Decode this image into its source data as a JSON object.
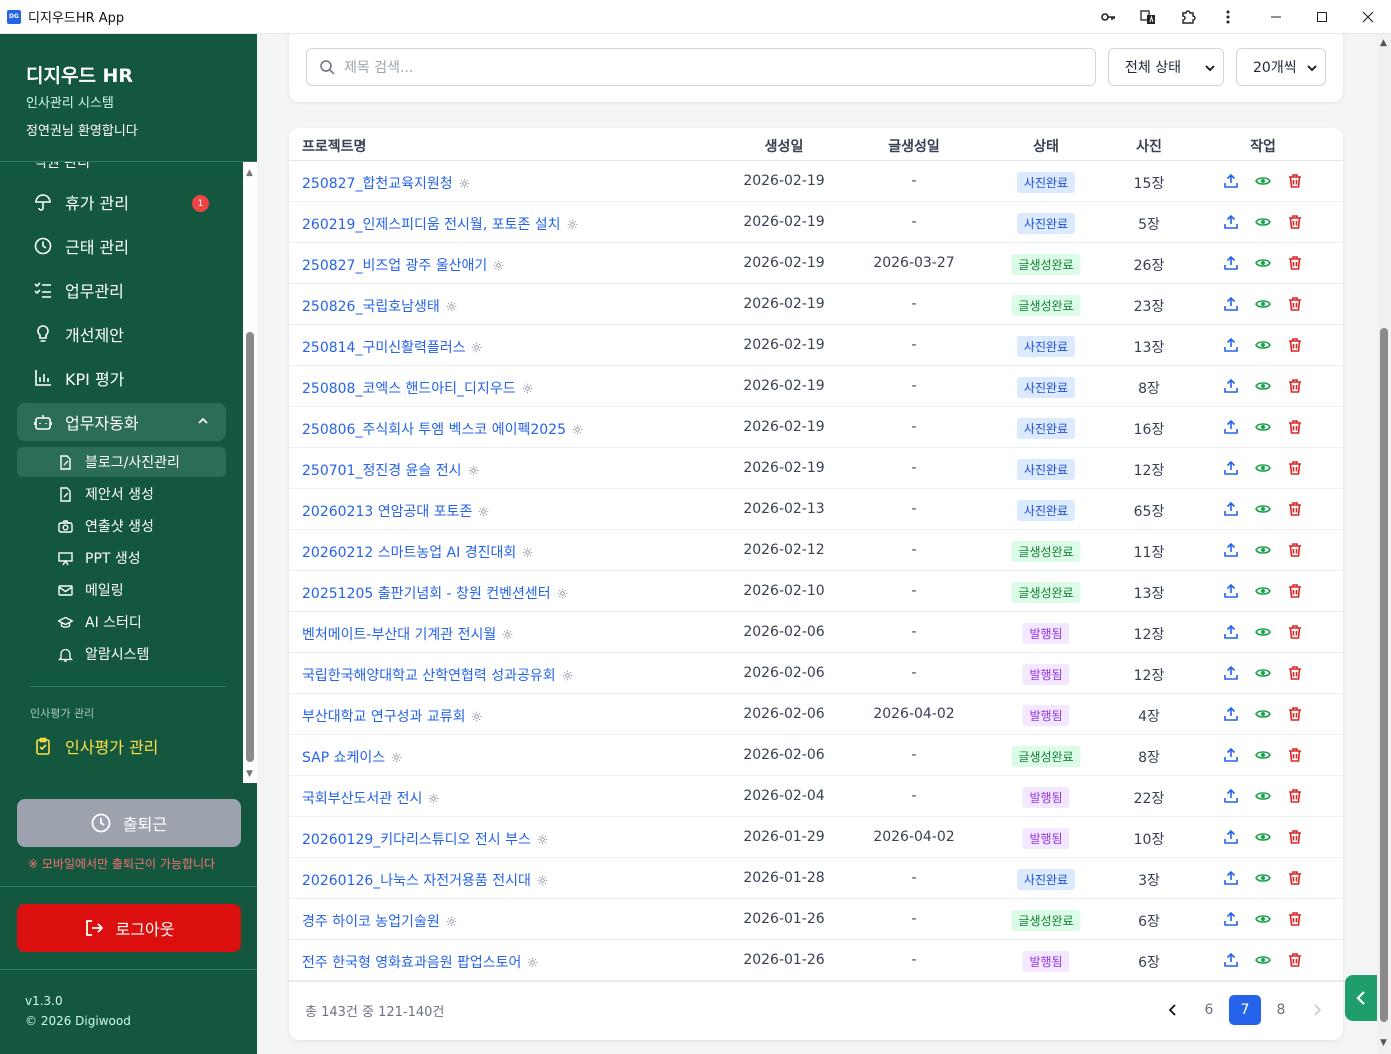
{
  "window": {
    "title": "디지우드HR App",
    "logo_text": "DG"
  },
  "sidebar": {
    "brand": "디지우드 HR",
    "subtitle": "인사관리 시스템",
    "welcome": "정연권님 환영합니다",
    "cut_item": "직원 관리",
    "items": [
      {
        "label": "휴가 관리",
        "icon": "umbrella-icon",
        "badge": "1"
      },
      {
        "label": "근태 관리",
        "icon": "clock-icon"
      },
      {
        "label": "업무관리",
        "icon": "task-list-icon"
      },
      {
        "label": "개선제안",
        "icon": "lightbulb-icon"
      },
      {
        "label": "KPI 평가",
        "icon": "bar-chart-icon"
      },
      {
        "label": "업무자동화",
        "icon": "robot-icon",
        "expanded": true
      }
    ],
    "sub_items": [
      {
        "label": "블로그/사진관리",
        "icon": "document-icon",
        "active": true
      },
      {
        "label": "제안서 생성",
        "icon": "document-icon"
      },
      {
        "label": "연출샷 생성",
        "icon": "camera-icon"
      },
      {
        "label": "PPT 생성",
        "icon": "presentation-icon"
      },
      {
        "label": "메일링",
        "icon": "mail-icon"
      },
      {
        "label": "AI 스터디",
        "icon": "graduation-cap-icon"
      },
      {
        "label": "알람시스템",
        "icon": "bell-icon"
      }
    ],
    "section_label": "인사평가 관리",
    "eval_item": "인사평가 관리",
    "clock_button": "출퇴근",
    "clock_note": "※ 모바일에서만 출퇴근이 가능합니다",
    "logout_button": "로그아웃",
    "version": "v1.3.0",
    "copyright": "© 2026 Digiwood"
  },
  "filters": {
    "search_placeholder": "제목 검색...",
    "status_select": "전체 상태",
    "page_size_select": "20개씩"
  },
  "table": {
    "headers": {
      "name": "프로젝트명",
      "created": "생성일",
      "written": "글생성일",
      "status": "상태",
      "photos": "사진",
      "actions": "작업"
    },
    "rows": [
      {
        "name": "250827_합천교육지원청",
        "created": "2026-02-19",
        "written": "-",
        "status": "사진완료",
        "photos": "15장"
      },
      {
        "name": "260219_인제스피디움 전시월, 포토존 설치",
        "created": "2026-02-19",
        "written": "-",
        "status": "사진완료",
        "photos": "5장"
      },
      {
        "name": "250827_비즈업 광주 울산애기",
        "created": "2026-02-19",
        "written": "2026-03-27",
        "status": "글생성완료",
        "photos": "26장"
      },
      {
        "name": "250826_국립호남생태",
        "created": "2026-02-19",
        "written": "-",
        "status": "글생성완료",
        "photos": "23장"
      },
      {
        "name": "250814_구미신활력플러스",
        "created": "2026-02-19",
        "written": "-",
        "status": "사진완료",
        "photos": "13장"
      },
      {
        "name": "250808_코엑스 핸드아티_디지우드",
        "created": "2026-02-19",
        "written": "-",
        "status": "사진완료",
        "photos": "8장"
      },
      {
        "name": "250806_주식회사 투엠 벡스코 에이펙2025",
        "created": "2026-02-19",
        "written": "-",
        "status": "사진완료",
        "photos": "16장"
      },
      {
        "name": "250701_정진경 윤슬 전시",
        "created": "2026-02-19",
        "written": "-",
        "status": "사진완료",
        "photos": "12장"
      },
      {
        "name": "20260213 연암공대 포토존",
        "created": "2026-02-13",
        "written": "-",
        "status": "사진완료",
        "photos": "65장"
      },
      {
        "name": "20260212 스마트농업 AI 경진대회",
        "created": "2026-02-12",
        "written": "-",
        "status": "글생성완료",
        "photos": "11장"
      },
      {
        "name": "20251205 출판기념회 - 창원 컨벤션센터",
        "created": "2026-02-10",
        "written": "-",
        "status": "글생성완료",
        "photos": "13장"
      },
      {
        "name": "벤처메이트-부산대 기계관 전시월",
        "created": "2026-02-06",
        "written": "-",
        "status": "발행됨",
        "photos": "12장"
      },
      {
        "name": "국립한국해양대학교 산학연협력 성과공유회",
        "created": "2026-02-06",
        "written": "-",
        "status": "발행됨",
        "photos": "12장"
      },
      {
        "name": "부산대학교 연구성과 교류회",
        "created": "2026-02-06",
        "written": "2026-04-02",
        "status": "발행됨",
        "photos": "4장"
      },
      {
        "name": "SAP 쇼케이스",
        "created": "2026-02-06",
        "written": "-",
        "status": "글생성완료",
        "photos": "8장"
      },
      {
        "name": "국회부산도서관 전시",
        "created": "2026-02-04",
        "written": "-",
        "status": "발행됨",
        "photos": "22장"
      },
      {
        "name": "20260129_키다리스튜디오 전시 부스",
        "created": "2026-01-29",
        "written": "2026-04-02",
        "status": "발행됨",
        "photos": "10장"
      },
      {
        "name": "20260126_나눅스 자전거용품 전시대",
        "created": "2026-01-28",
        "written": "-",
        "status": "사진완료",
        "photos": "3장"
      },
      {
        "name": "경주 하이코 농업기술원",
        "created": "2026-01-26",
        "written": "-",
        "status": "글생성완료",
        "photos": "6장"
      },
      {
        "name": "전주 한국형 영화효과음원 팝업스토어",
        "created": "2026-01-26",
        "written": "-",
        "status": "발행됨",
        "photos": "6장"
      }
    ],
    "status_colors": {
      "사진완료": "blue",
      "글생성완료": "green",
      "발행됨": "purple"
    },
    "total_text": "총 143건 중 121-140건",
    "pages": [
      "6",
      "7",
      "8"
    ],
    "current_page": "7"
  },
  "colors": {
    "sidebar": "#14573f",
    "accent": "#2563eb",
    "logout": "#dc0f0f",
    "clock_disabled": "#9ca3af"
  }
}
